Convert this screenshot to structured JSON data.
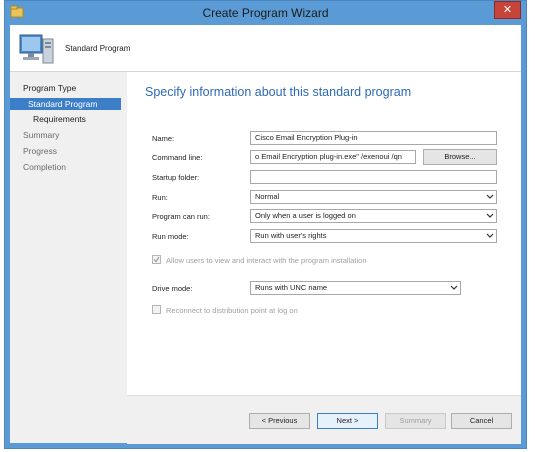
{
  "window": {
    "title": "Create Program Wizard",
    "close_glyph": "✕"
  },
  "banner": {
    "label": "Standard Program",
    "icon": "computer-icon"
  },
  "nav": {
    "items": [
      {
        "label": "Program Type",
        "state": "section"
      },
      {
        "label": "Standard Program",
        "state": "selected"
      },
      {
        "label": "Requirements",
        "state": "section-child"
      },
      {
        "label": "Summary",
        "state": "pending"
      },
      {
        "label": "Progress",
        "state": "pending"
      },
      {
        "label": "Completion",
        "state": "pending"
      }
    ]
  },
  "main": {
    "heading": "Specify information about this standard program",
    "name": {
      "label": "Name:",
      "value": "Cisco Email Encryption Plug-in"
    },
    "command_line": {
      "label": "Command line:",
      "value": "o Email Encryption plug-in.exe\" /exenoui /qn",
      "browse": "Browse..."
    },
    "startup_folder": {
      "label": "Startup folder:",
      "value": ""
    },
    "run": {
      "label": "Run:",
      "value": "Normal"
    },
    "can_run": {
      "label": "Program can run:",
      "value": "Only when a user is logged on"
    },
    "run_mode": {
      "label": "Run mode:",
      "value": "Run with user's rights"
    },
    "allow_interact": {
      "label": "Allow users to view and interact with the program installation",
      "checked": true,
      "enabled": false
    },
    "drive_mode": {
      "label": "Drive mode:",
      "value": "Runs with UNC name"
    },
    "reconnect": {
      "label": "Reconnect to distribution point at log on",
      "checked": false,
      "enabled": false
    }
  },
  "footer": {
    "previous": "< Previous",
    "next": "Next >",
    "summary": "Summary",
    "cancel": "Cancel"
  },
  "colors": {
    "titlebar": "#5b9bd5",
    "nav_selected": "#3c7fc8",
    "heading": "#2e6ab0",
    "close": "#c7443a"
  }
}
